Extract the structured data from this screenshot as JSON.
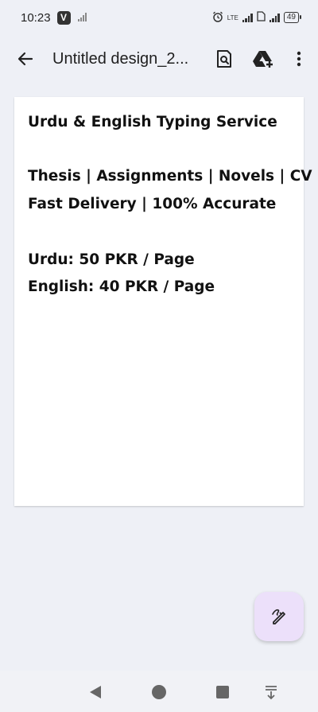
{
  "status_bar": {
    "time": "10:23",
    "app_badge": "V",
    "network_type": "LTE",
    "battery_level": "49"
  },
  "app_bar": {
    "title": "Untitled design_2..."
  },
  "document": {
    "lines": [
      "Urdu & English Typing Service",
      "Thesis | Assignments | Novels | CV",
      "Fast Delivery | 100% Accurate",
      "Urdu: 50 PKR / Page",
      "English: 40 PKR / Page"
    ]
  },
  "colors": {
    "background": "#eef0f6",
    "fab_background": "#ece0fa",
    "page": "#ffffff"
  },
  "icons": {
    "back": "arrow-left-icon",
    "preview": "document-search-icon",
    "drive": "drive-add-icon",
    "more": "more-vert-icon",
    "fab": "edit-pen-icon",
    "nav_back": "triangle-back-icon",
    "nav_home": "circle-home-icon",
    "nav_recents": "square-recents-icon",
    "nav_menu": "download-menu-icon"
  }
}
